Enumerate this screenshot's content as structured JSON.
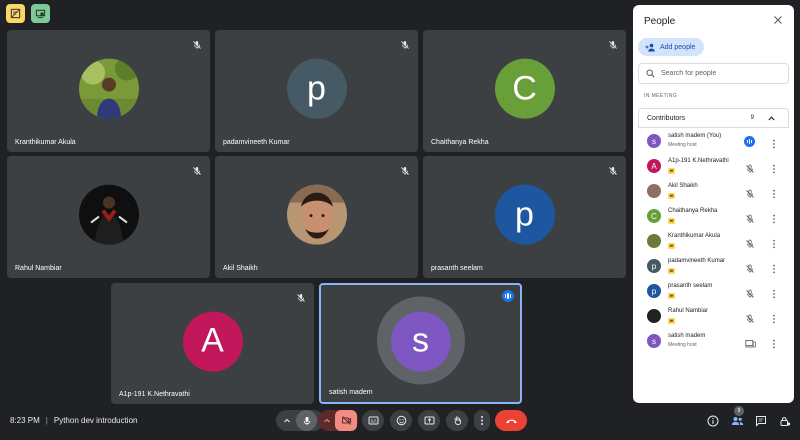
{
  "top_buttons": [
    {
      "icon": "activities-icon",
      "color": "#fdd663"
    },
    {
      "icon": "cast-icon",
      "color": "#81c995"
    }
  ],
  "tiles": [
    {
      "name": "Kranthikumar Akula",
      "initial": "",
      "avatar_type": "photo-green",
      "muted": true
    },
    {
      "name": "padamvineeth Kumar",
      "initial": "p",
      "avatar_color": "#455a64",
      "muted": true
    },
    {
      "name": "Chaithanya Rekha",
      "initial": "C",
      "avatar_color": "#689f38",
      "muted": true
    },
    {
      "name": "Rahul Nambiar",
      "initial": "",
      "avatar_type": "photo-dark",
      "muted": true
    },
    {
      "name": "Akil Shaikh",
      "initial": "",
      "avatar_type": "photo-face",
      "muted": true
    },
    {
      "name": "prasanth seelam",
      "initial": "p",
      "avatar_color": "#1e56a0",
      "muted": true
    },
    {
      "name": "A1p-191 K.Nethravathi",
      "initial": "A",
      "avatar_color": "#c2185b",
      "muted": true
    },
    {
      "name": "satish madem",
      "initial": "s",
      "avatar_color": "#7e57c2",
      "muted": false,
      "speaking": true
    }
  ],
  "meeting": {
    "time": "8:23 PM",
    "separator": "|",
    "title": "Python dev introduction"
  },
  "controls": {
    "people_count": "9"
  },
  "panel": {
    "title": "People",
    "add_people_label": "Add people",
    "search_placeholder": "Search for people",
    "section_label": "IN MEETING",
    "contributors_label": "Contributors",
    "contributors_count": "9",
    "participants": [
      {
        "name": "satish madem (You)",
        "sub": "Meeting host",
        "initial": "s",
        "color": "#7e57c2",
        "mic": "speaking"
      },
      {
        "name": "A1p-191 K.Nethravathi",
        "sub": "",
        "initial": "A",
        "color": "#c2185b",
        "mic": "muted",
        "badge": true
      },
      {
        "name": "Akil Shaikh",
        "sub": "",
        "initial": "",
        "color": "#8d6e63",
        "mic": "muted",
        "badge": true,
        "photo": true
      },
      {
        "name": "Chaithanya Rekha",
        "sub": "",
        "initial": "C",
        "color": "#689f38",
        "mic": "muted",
        "badge": true
      },
      {
        "name": "Kranthikumar Akula",
        "sub": "",
        "initial": "",
        "color": "#6d7b3a",
        "mic": "muted",
        "badge": true,
        "photo": true
      },
      {
        "name": "padamvineeth Kumar",
        "sub": "",
        "initial": "p",
        "color": "#455a64",
        "mic": "muted",
        "badge": true
      },
      {
        "name": "prasanth seelam",
        "sub": "",
        "initial": "p",
        "color": "#1e56a0",
        "mic": "muted",
        "badge": true
      },
      {
        "name": "Rahul Nambiar",
        "sub": "",
        "initial": "",
        "color": "#222222",
        "mic": "muted",
        "badge": true,
        "photo": true
      },
      {
        "name": "satish madem",
        "sub": "Meeting host",
        "initial": "s",
        "color": "#7e57c2",
        "mic": "device"
      }
    ]
  }
}
